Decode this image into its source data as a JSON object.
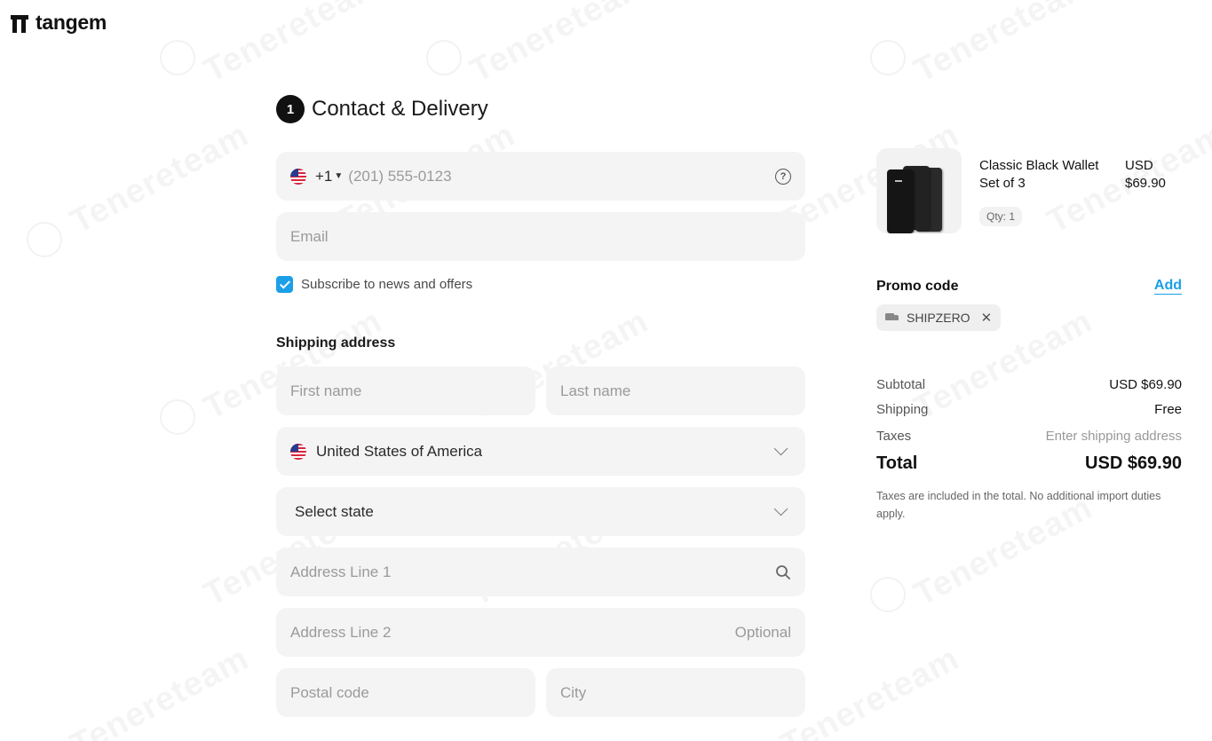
{
  "brand": {
    "name": "tangem"
  },
  "watermark": {
    "text": "Tenereteam"
  },
  "checkout": {
    "step_number": "1",
    "step_title": "Contact & Delivery",
    "phone": {
      "country_code": "+1",
      "placeholder": "(201) 555-0123",
      "help_icon": "question-circle-icon"
    },
    "email": {
      "placeholder": "Email"
    },
    "subscribe": {
      "label": "Subscribe to news and offers",
      "checked": true
    },
    "shipping_title": "Shipping address",
    "first_name": {
      "placeholder": "First name"
    },
    "last_name": {
      "placeholder": "Last name"
    },
    "country": {
      "value": "United States of America"
    },
    "state": {
      "value": "Select state"
    },
    "address1": {
      "placeholder": "Address Line 1",
      "icon": "search-icon"
    },
    "address2": {
      "placeholder": "Address Line 2",
      "hint": "Optional"
    },
    "postal": {
      "placeholder": "Postal code"
    },
    "city": {
      "placeholder": "City"
    }
  },
  "summary": {
    "product": {
      "name": "Classic Black Wallet Set of 3",
      "currency": "USD",
      "price": "$69.90",
      "qty": "Qty: 1"
    },
    "promo": {
      "label": "Promo code",
      "add_label": "Add",
      "code": "SHIPZERO"
    },
    "rows": [
      {
        "label": "Subtotal",
        "value": "USD $69.90"
      },
      {
        "label": "Shipping",
        "value": "Free"
      },
      {
        "label": "Taxes",
        "value": "Enter shipping address"
      }
    ],
    "total": {
      "label": "Total",
      "value": "USD $69.90"
    },
    "note": "Taxes are included in the total. No additional import duties apply."
  },
  "colors": {
    "accent": "#1a9fe8",
    "field_bg": "#f4f4f4",
    "text": "#1f1f1f"
  }
}
